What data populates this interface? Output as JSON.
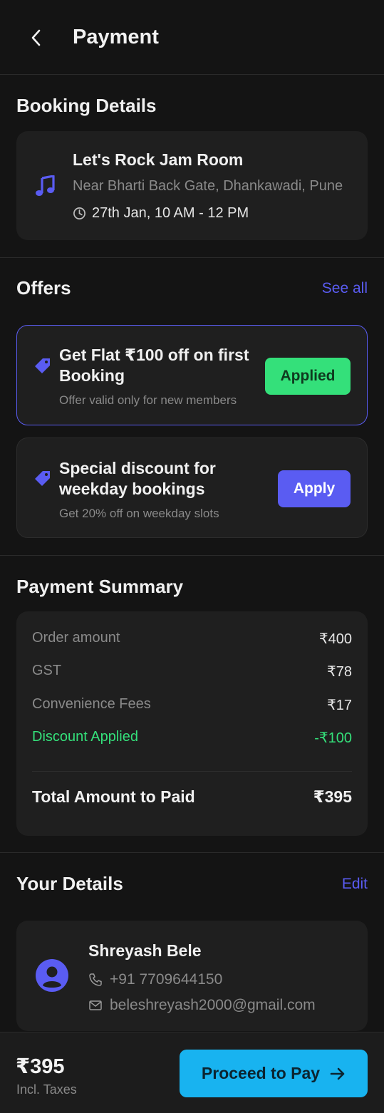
{
  "header": {
    "title": "Payment"
  },
  "booking": {
    "section_title": "Booking Details",
    "venue_name": "Let's Rock Jam Room",
    "address": "Near Bharti Back Gate, Dhankawadi, Pune",
    "time": "27th Jan, 10 AM - 12 PM"
  },
  "offers": {
    "section_title": "Offers",
    "see_all": "See all",
    "items": [
      {
        "title": "Get Flat ₹100 off on first Booking",
        "subtitle": "Offer valid only for new members",
        "button": "Applied"
      },
      {
        "title": "Special discount for weekday bookings",
        "subtitle": "Get 20% off on weekday slots",
        "button": "Apply"
      }
    ]
  },
  "summary": {
    "section_title": "Payment Summary",
    "rows": [
      {
        "label": "Order amount",
        "value": "₹400"
      },
      {
        "label": "GST",
        "value": "₹78"
      },
      {
        "label": "Convenience Fees",
        "value": "₹17"
      },
      {
        "label": "Discount Applied",
        "value": "-₹100"
      }
    ],
    "total_label": "Total Amount to Paid",
    "total_value": "₹395"
  },
  "details": {
    "section_title": "Your Details",
    "edit": "Edit",
    "name": "Shreyash Bele",
    "phone": "+91 7709644150",
    "email": "beleshreyash2000@gmail.com"
  },
  "footer": {
    "amount": "₹395",
    "incl_taxes": "Incl. Taxes",
    "pay_button": "Proceed to Pay"
  },
  "colors": {
    "background": "#141414",
    "card": "#1f1f1f",
    "accent": "#5a5cf2",
    "success": "#34e07a",
    "pay_button": "#18b3f0"
  }
}
